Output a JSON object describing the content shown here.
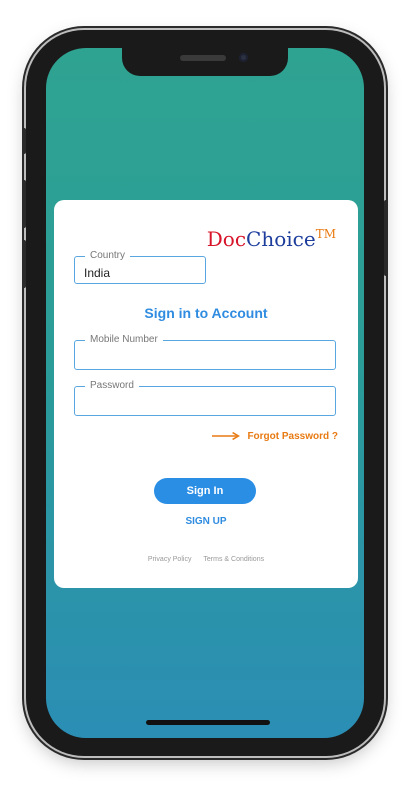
{
  "logo": {
    "part1": "Doc",
    "part2": "Choice",
    "tm": "TM"
  },
  "country": {
    "label": "Country",
    "value": "India"
  },
  "title": "Sign in to Account",
  "mobile": {
    "label": "Mobile Number",
    "value": ""
  },
  "password": {
    "label": "Password",
    "value": ""
  },
  "forgot_password": "Forgot Password ?",
  "signin_label": "Sign In",
  "signup_label": "SIGN UP",
  "footer": {
    "privacy": "Privacy Policy",
    "terms": "Terms & Conditions"
  },
  "colors": {
    "accent": "#2b8ee5",
    "forgot": "#e87a12",
    "logo_red": "#d8142a",
    "logo_blue": "#1c3d9c",
    "bg_top": "#2fa392",
    "bg_bottom": "#2b8eb5"
  },
  "icons": {
    "forgot_arrow": "arrow-right-icon"
  }
}
